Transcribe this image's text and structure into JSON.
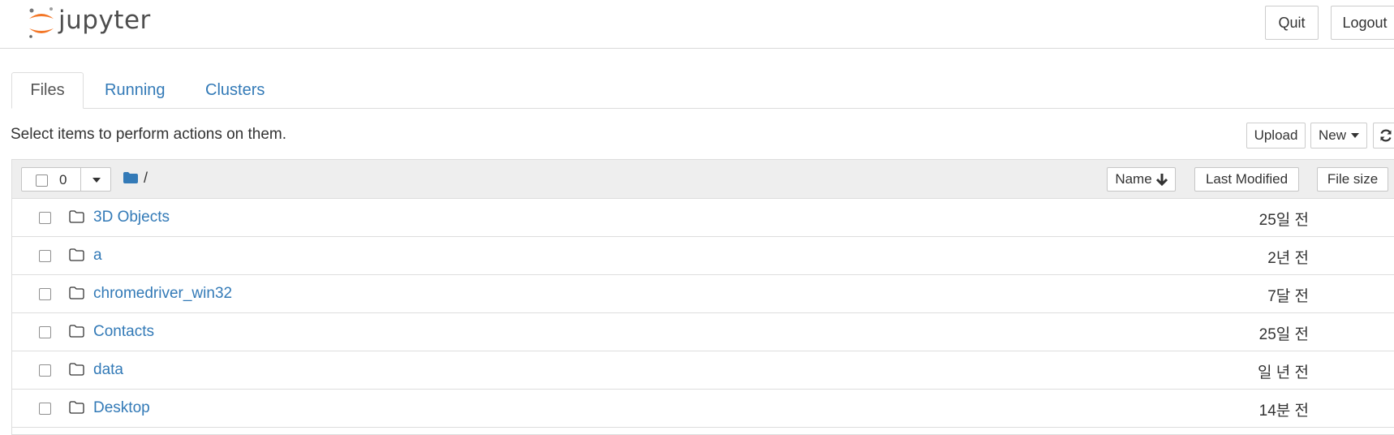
{
  "header": {
    "logo_text": "jupyter",
    "quit_label": "Quit",
    "logout_label": "Logout"
  },
  "tabs": [
    {
      "label": "Files",
      "active": true
    },
    {
      "label": "Running",
      "active": false
    },
    {
      "label": "Clusters",
      "active": false
    }
  ],
  "toolbar": {
    "select_message": "Select items to perform actions on them.",
    "upload_label": "Upload",
    "new_label": "New"
  },
  "list_header": {
    "selected_count": "0",
    "breadcrumb": "/",
    "sort_name_label": "Name",
    "sort_modified_label": "Last Modified",
    "sort_size_label": "File size"
  },
  "items": [
    {
      "name": "3D Objects",
      "modified": "25일 전"
    },
    {
      "name": "a",
      "modified": "2년 전"
    },
    {
      "name": "chromedriver_win32",
      "modified": "7달 전"
    },
    {
      "name": "Contacts",
      "modified": "25일 전"
    },
    {
      "name": "data",
      "modified": "일 년 전"
    },
    {
      "name": "Desktop",
      "modified": "14분 전"
    }
  ],
  "colors": {
    "link": "#337ab7",
    "logo_orange": "#f37626",
    "header_bg": "#eeeeee"
  }
}
